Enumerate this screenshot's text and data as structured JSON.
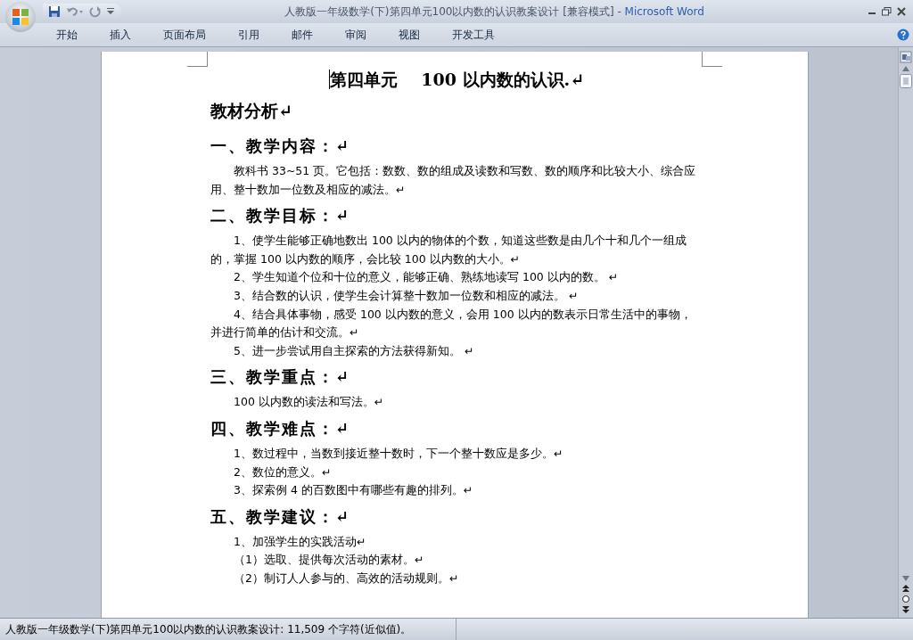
{
  "window": {
    "title": "人教版一年级数学(下)第四单元100以内数的认识教案设计 [兼容模式]",
    "separator": "-",
    "app": "Microsoft Word"
  },
  "tabs": [
    {
      "label": "开始",
      "selected": false
    },
    {
      "label": "插入",
      "selected": false
    },
    {
      "label": "页面布局",
      "selected": false
    },
    {
      "label": "引用",
      "selected": false
    },
    {
      "label": "邮件",
      "selected": false
    },
    {
      "label": "审阅",
      "selected": false
    },
    {
      "label": "视图",
      "selected": false
    },
    {
      "label": "开发工具",
      "selected": false
    }
  ],
  "document": {
    "blocks": [
      {
        "kind": "title",
        "text": "第四单元    100 以内数的认识.↵"
      },
      {
        "kind": "heading1",
        "text": "教材分析↵"
      },
      {
        "kind": "heading2",
        "text": "一、教学内容：↵"
      },
      {
        "kind": "para",
        "text": "教科书 33~51 页。它包括：数数、数的组成及读数和写数、数的顺序和比较大小、综合应用、整十数加一位数及相应的减法。↵"
      },
      {
        "kind": "heading2",
        "text": "二、教学目标：↵"
      },
      {
        "kind": "para",
        "text": "1、使学生能够正确地数出 100 以内的物体的个数，知道这些数是由几个十和几个一组成的，掌握 100 以内数的顺序，会比较 100 以内数的大小。↵"
      },
      {
        "kind": "para",
        "text": "2、学生知道个位和十位的意义，能够正确、熟练地读写 100 以内的数。 ↵"
      },
      {
        "kind": "para",
        "text": "3、结合数的认识，使学生会计算整十数加一位数和相应的减法。 ↵"
      },
      {
        "kind": "para",
        "text": "4、结合具体事物，感受 100 以内数的意义，会用 100 以内的数表示日常生活中的事物，并进行简单的估计和交流。↵"
      },
      {
        "kind": "para",
        "text": "5、进一步尝试用自主探索的方法获得新知。 ↵"
      },
      {
        "kind": "heading2",
        "text": "三、教学重点：↵"
      },
      {
        "kind": "para",
        "text": "100 以内数的读法和写法。↵"
      },
      {
        "kind": "heading2",
        "text": "四、教学难点：↵"
      },
      {
        "kind": "para",
        "text": "1、数过程中，当数到接近整十数时，下一个整十数应是多少。↵"
      },
      {
        "kind": "para",
        "text": "2、数位的意义。↵"
      },
      {
        "kind": "para",
        "text": "3、探索例 4 的百数图中有哪些有趣的排列。↵"
      },
      {
        "kind": "heading2",
        "text": "五、教学建议：↵"
      },
      {
        "kind": "para",
        "text": "1、加强学生的实践活动↵"
      },
      {
        "kind": "para",
        "text": "（1）选取、提供每次活动的素材。↵"
      },
      {
        "kind": "para",
        "text": "（2）制订人人参与的、高效的活动规则。↵"
      }
    ]
  },
  "status_bar": {
    "text": "人教版一年级数学(下)第四单元100以内数的认识教案设计: 11,509 个字符(近似值)。"
  }
}
